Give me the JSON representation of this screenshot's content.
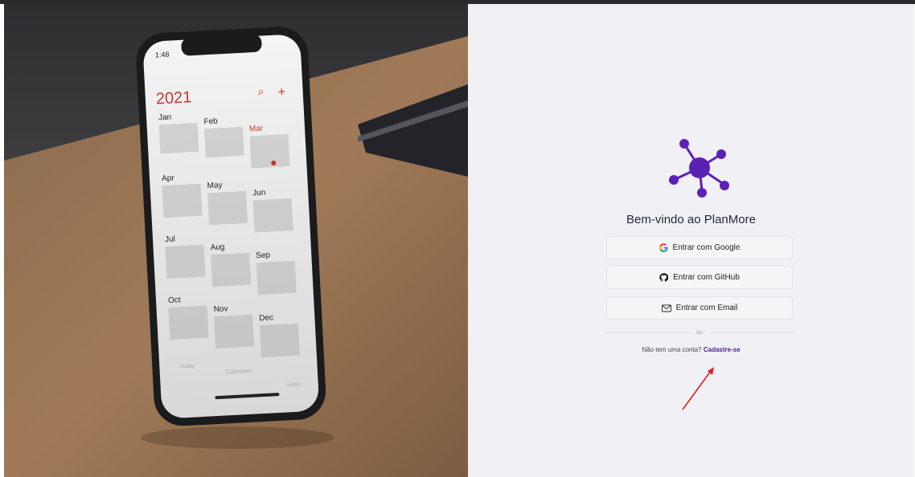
{
  "phone": {
    "time": "1:48",
    "year": "2021",
    "months": [
      "Jan",
      "Feb",
      "Mar",
      "Apr",
      "May",
      "Jun",
      "Jul",
      "Aug",
      "Sep",
      "Oct",
      "Nov",
      "Dec"
    ],
    "tabs": [
      "Today",
      "Calendars",
      "Inbox"
    ]
  },
  "login": {
    "welcome": "Bem-vindo ao PlanMore",
    "google_label": "Entrar com Google",
    "github_label": "Entrar com GitHub",
    "email_label": "Entrar com Email",
    "or_label": "ou",
    "signup_prompt": "Não tem uma conta?",
    "signup_link": "Cadastre-se"
  },
  "colors": {
    "brand": "#5b21b6",
    "link": "#4c1d95",
    "panel_bg": "#f1f0f5",
    "arrow": "#e11d1d"
  },
  "icons": {
    "logo": "network-hub-icon",
    "google": "google-icon",
    "github": "github-icon",
    "email": "envelope-icon"
  }
}
